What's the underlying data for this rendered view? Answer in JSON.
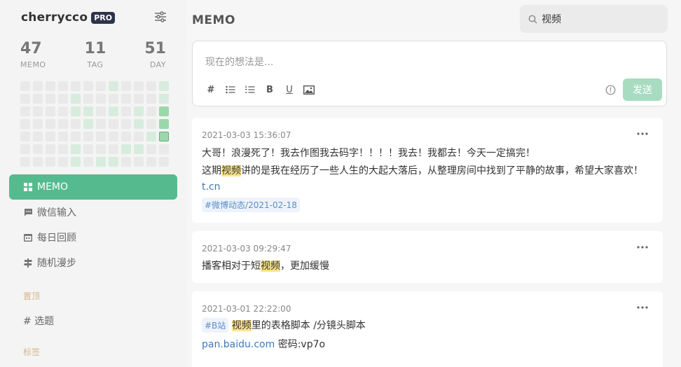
{
  "sidebar": {
    "brand": "cherrycco",
    "badge": "PRO",
    "stats": [
      {
        "value": "47",
        "label": "MEMO"
      },
      {
        "value": "11",
        "label": "TAG"
      },
      {
        "value": "51",
        "label": "DAY"
      }
    ],
    "heatmap_levels": [
      0,
      0,
      0,
      0,
      0,
      0,
      0,
      1,
      0,
      0,
      0,
      1,
      0,
      0,
      0,
      0,
      1,
      0,
      0,
      0,
      0,
      0,
      0,
      1,
      0,
      0,
      0,
      0,
      1,
      1,
      0,
      1,
      0,
      1,
      0,
      3,
      0,
      0,
      0,
      0,
      0,
      1,
      0,
      0,
      0,
      1,
      0,
      3,
      0,
      0,
      0,
      0,
      0,
      0,
      0,
      0,
      0,
      0,
      1,
      4,
      0,
      0,
      0,
      0,
      1,
      0,
      0,
      0,
      1,
      1,
      0,
      0,
      0,
      0,
      0,
      0,
      1,
      0,
      1,
      1,
      0,
      0,
      0,
      0
    ],
    "nav": [
      {
        "label": "MEMO",
        "icon": "grid-icon",
        "active": true
      },
      {
        "label": "微信输入",
        "icon": "chat-icon",
        "active": false
      },
      {
        "label": "每日回顾",
        "icon": "calendar-icon",
        "active": false
      },
      {
        "label": "随机漫步",
        "icon": "signpost-icon",
        "active": false
      }
    ],
    "pinned_title": "置顶",
    "pinned_item": "# 选题",
    "tags_title": "标签"
  },
  "main": {
    "title": "MEMO",
    "search_value": "视频",
    "editor_placeholder": "现在的想法是...",
    "send_label": "发送",
    "accent_color": "#55bb8e"
  },
  "memos": [
    {
      "time": "2021-03-03 15:36:07",
      "line1": "大哥！浪漫死了！我去作图我去码字！！！！我去！我都去！今天一定搞完！",
      "line2_pre": "这期",
      "line2_hl": "视频",
      "line2_post": "讲的是我在经历了一些人生的大起大落后，从整理房间中找到了平静的故事，希望大家喜欢！",
      "link": "t.cn",
      "tag": "#微博动态/2021-02-18"
    },
    {
      "time": "2021-03-03 09:29:47",
      "line1_pre": "播客相对于短",
      "line1_hl": "视频",
      "line1_post": "，更加缓慢"
    },
    {
      "time": "2021-03-01 22:22:00",
      "tag": "#B站",
      "line1_hl": "视频",
      "line1_post": "里的表格脚本 /分镜头脚本",
      "link": "pan.baidu.com",
      "link_suffix": " 密码:vp7o"
    }
  ]
}
